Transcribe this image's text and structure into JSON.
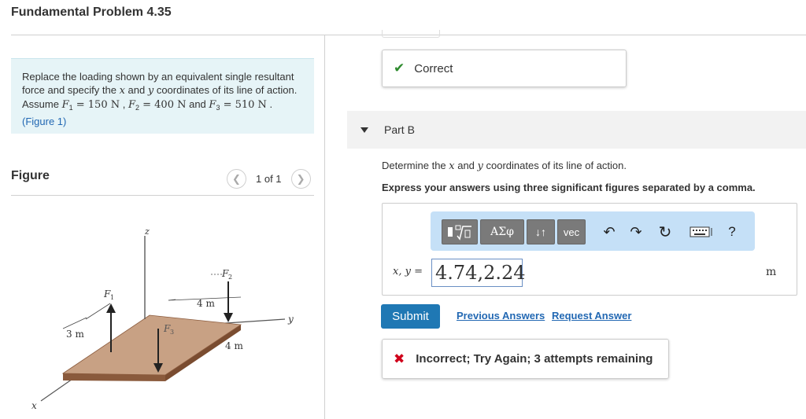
{
  "page": {
    "title": "Fundamental Problem 4.35"
  },
  "problem": {
    "text_1": "Replace the loading shown by an equivalent single resultant force and specify the ",
    "var_x": "x",
    "text_and": " and ",
    "var_y": "y",
    "text_2": " coordinates of its line of action. Assume ",
    "F1_sym": "F",
    "F1_sub": "1",
    "F1_val": " = 150 N",
    "sep1": " , ",
    "F2_sym": "F",
    "F2_sub": "2",
    "F2_val": " = 400 N",
    "text_and2": " and ",
    "F3_sym": "F",
    "F3_sub": "3",
    "F3_val": " = 510 N",
    "period": " .",
    "figure_link": "(Figure 1)"
  },
  "figure": {
    "label": "Figure",
    "pager_text": "1 of 1",
    "labels": {
      "z": "z",
      "F1": "F",
      "F1_sub": "1",
      "F2": "F",
      "F2_sub": "2",
      "F3": "F",
      "F3_sub": "3",
      "dim_4m_top": "4 m",
      "dim_3m": "3 m",
      "dim_4m_bottom": "4 m",
      "y_axis": "y",
      "x_axis": "x"
    },
    "colors": {
      "plate_top": "#c8a184",
      "plate_side": "#8a5a3c",
      "force_arrow": "#222222"
    }
  },
  "feedback_correct": {
    "text": "Correct"
  },
  "part_b": {
    "label": "Part B",
    "instruction_1": "Determine the ",
    "var_x": "x",
    "instruction_and": " and ",
    "var_y": "y",
    "instruction_2": " coordinates of its line of action.",
    "express": "Express your answers using three significant figures separated by a comma."
  },
  "toolbar": {
    "templates_icon": "templates-icon",
    "greek_label": "ΑΣφ",
    "arrows_label": "↓↑",
    "vec_label": "vec",
    "undo_icon": "undo-icon",
    "redo_icon": "redo-icon",
    "reset_icon": "reset-icon",
    "keyboard_icon": "keyboard-icon",
    "help_label": "?"
  },
  "answer": {
    "var_label": "x, y =",
    "value": "4.74,2.24",
    "unit": "m"
  },
  "actions": {
    "submit": "Submit",
    "previous_answers": "Previous Answers",
    "request_answer": "Request Answer"
  },
  "feedback_incorrect": {
    "text": "Incorrect; Try Again; 3 attempts remaining"
  },
  "colors": {
    "accent": "#1f78b4",
    "link": "#2268b3",
    "correct": "#2e8b2e",
    "incorrect": "#d0021b",
    "problem_bg": "#e6f4f7",
    "toolbar_bg": "#c5e0f7"
  }
}
